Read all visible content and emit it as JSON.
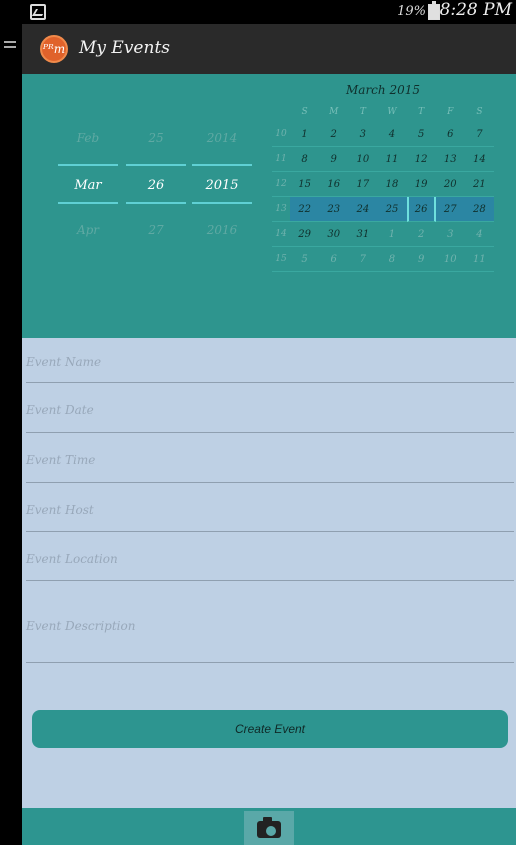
{
  "status_bar": {
    "battery": "19%",
    "time": "8:28 PM"
  },
  "action_bar": {
    "logo_text": "ᴾᴿm",
    "title": "My Events"
  },
  "date_spinner": {
    "months": [
      "Feb",
      "Mar",
      "Apr"
    ],
    "days": [
      "25",
      "26",
      "27"
    ],
    "years": [
      "2014",
      "2015",
      "2016"
    ]
  },
  "calendar": {
    "title": "March 2015",
    "weekdays": [
      "S",
      "M",
      "T",
      "W",
      "T",
      "F",
      "S"
    ],
    "weeks": [
      {
        "num": "10",
        "days": [
          "1",
          "2",
          "3",
          "4",
          "5",
          "6",
          "7"
        ]
      },
      {
        "num": "11",
        "days": [
          "8",
          "9",
          "10",
          "11",
          "12",
          "13",
          "14"
        ]
      },
      {
        "num": "12",
        "days": [
          "15",
          "16",
          "17",
          "18",
          "19",
          "20",
          "21"
        ]
      },
      {
        "num": "13",
        "days": [
          "22",
          "23",
          "24",
          "25",
          "26",
          "27",
          "28"
        ]
      },
      {
        "num": "14",
        "days": [
          "29",
          "30",
          "31",
          "1",
          "2",
          "3",
          "4"
        ]
      },
      {
        "num": "15",
        "days": [
          "5",
          "6",
          "7",
          "8",
          "9",
          "10",
          "11"
        ]
      }
    ]
  },
  "form": {
    "event_name_placeholder": "Event Name",
    "event_date_placeholder": "Event Date",
    "event_time_placeholder": "Event Time",
    "event_host_placeholder": "Event Host",
    "event_location_placeholder": "Event Location",
    "event_description_placeholder": "Event Description",
    "create_button": "Create Event"
  },
  "icons": {
    "camera": "camera-icon"
  }
}
